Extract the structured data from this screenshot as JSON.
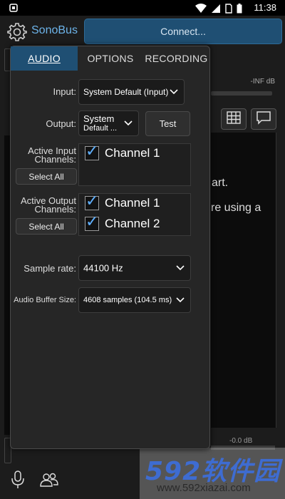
{
  "status_bar": {
    "time": "11:38",
    "icons": [
      "wifi-icon",
      "signal-icon",
      "sim-icon",
      "battery-icon"
    ]
  },
  "header": {
    "brand": "SonoBus",
    "connect_label": "Connect..."
  },
  "background": {
    "meter_label": "-INF dB",
    "text_line1": "art.",
    "text_line2": "re using a",
    "bottom_level": "-0.0 dB"
  },
  "settings_panel": {
    "tabs": [
      {
        "label": "AUDIO",
        "active": true
      },
      {
        "label": "OPTIONS",
        "active": false
      },
      {
        "label": "RECORDING",
        "active": false
      }
    ],
    "input": {
      "label": "Input:",
      "value": "System Default (Input)"
    },
    "output": {
      "label": "Output:",
      "value_line1": "System",
      "value_line2": "Default ..."
    },
    "test_label": "Test",
    "active_input": {
      "label_line1": "Active Input",
      "label_line2": "Channels:",
      "select_all": "Select All",
      "channels": [
        {
          "name": "Channel 1",
          "checked": true
        }
      ]
    },
    "active_output": {
      "label_line1": "Active Output",
      "label_line2": "Channels:",
      "select_all": "Select All",
      "channels": [
        {
          "name": "Channel 1",
          "checked": true
        },
        {
          "name": "Channel 2",
          "checked": true
        }
      ]
    },
    "sample_rate": {
      "label": "Sample rate:",
      "value": "44100 Hz"
    },
    "buffer_size": {
      "label": "Audio Buffer Size:",
      "value": "4608 samples (104.5 ms)"
    }
  },
  "watermark": {
    "brand": "592软件园",
    "url": "www.592xiazai.com"
  },
  "colors": {
    "accent": "#1f4f73",
    "brand": "#6db4ea",
    "check": "#5fb0ff"
  }
}
